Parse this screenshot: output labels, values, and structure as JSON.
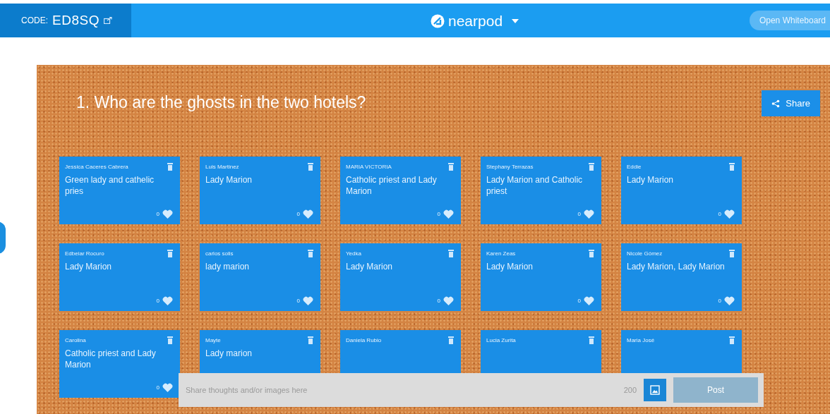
{
  "header": {
    "code_label": "CODE:",
    "code": "ED8SQ",
    "brand": "nearpod",
    "whiteboard_button": "Open Whiteboard"
  },
  "board": {
    "question": "1. Who are the ghosts in the two hotels?",
    "share_button": "Share",
    "posts": [
      {
        "author": "Jessica Caceres Cabrera",
        "text": "Green lady and cathelic pries",
        "likes": "0"
      },
      {
        "author": "Luis Martinez",
        "text": "Lady Marion",
        "likes": "0"
      },
      {
        "author": "MARIA VICTORIA",
        "text": "Catholic priest and Lady Marion",
        "likes": "0"
      },
      {
        "author": "Stephany Terrazas",
        "text": "Lady Marion and Catholic priest",
        "likes": "0"
      },
      {
        "author": "Eddie",
        "text": "Lady Marion",
        "likes": "0"
      },
      {
        "author": "Edbeiar Rocuro",
        "text": "Lady Marion",
        "likes": "0"
      },
      {
        "author": "carlos solis",
        "text": "lady marion",
        "likes": "0"
      },
      {
        "author": "Yedka",
        "text": "Lady Marion",
        "likes": "0"
      },
      {
        "author": "Karen Zeas",
        "text": "Lady Marion",
        "likes": "0"
      },
      {
        "author": "Nicole Gómez",
        "text": "Lady Marion, Lady Marion",
        "likes": "0"
      },
      {
        "author": "Carolina",
        "text": "Catholic priest and Lady Marion",
        "likes": "0"
      },
      {
        "author": "Mayte",
        "text": "Lady marion"
      },
      {
        "author": "Daniela Rubio"
      },
      {
        "author": "Lucia Zurita"
      },
      {
        "author": "Maria José"
      }
    ]
  },
  "composer": {
    "placeholder": "Share thoughts and/or images here",
    "char_count": "200",
    "post_button": "Post",
    "post_disabled": true
  }
}
